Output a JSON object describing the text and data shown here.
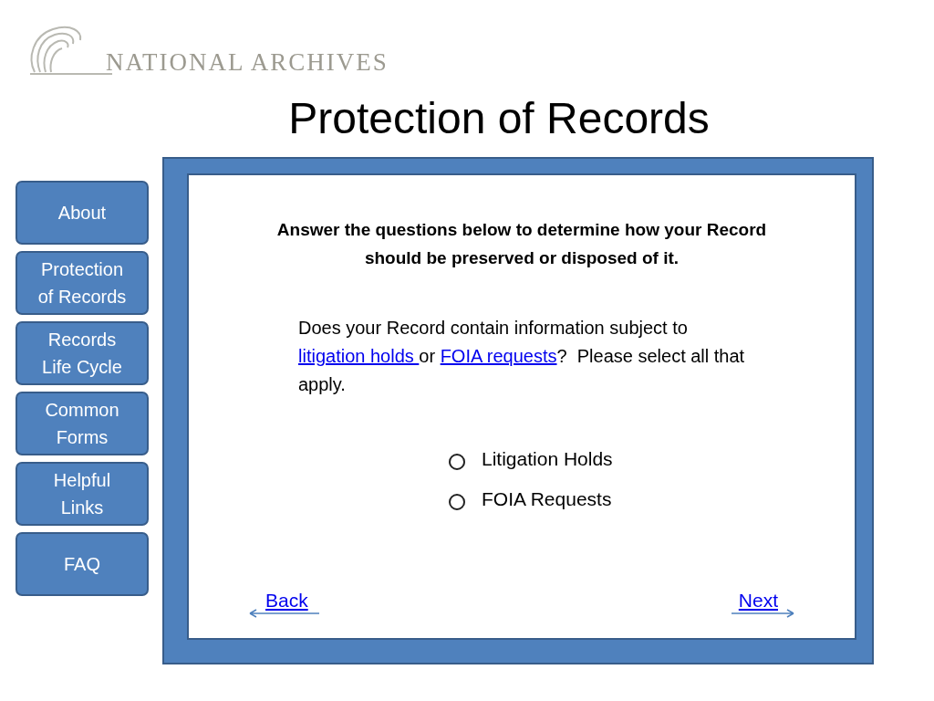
{
  "logo": {
    "text": "NATIONAL ARCHIVES"
  },
  "title": "Protection of Records",
  "nav": [
    {
      "label": "About"
    },
    {
      "label": "Protection of Records"
    },
    {
      "label": "Records Life Cycle"
    },
    {
      "label": "Common Forms"
    },
    {
      "label": "Helpful Links"
    },
    {
      "label": "FAQ"
    }
  ],
  "instructions": "Answer the questions below to determine how  your Record should be preserved or disposed of it.",
  "question": [
    {
      "kind": "text",
      "text": "Does your Record contain information subject to "
    },
    {
      "kind": "link",
      "text": "litigation holds "
    },
    {
      "kind": "text",
      "text": "or "
    },
    {
      "kind": "link",
      "text": "FOIA requests"
    },
    {
      "kind": "text",
      "text": "?  Please select all that apply."
    }
  ],
  "options": [
    {
      "label": "Litigation Holds",
      "selected": false
    },
    {
      "label": "FOIA Requests",
      "selected": false
    }
  ],
  "back": "Back",
  "next": "Next"
}
